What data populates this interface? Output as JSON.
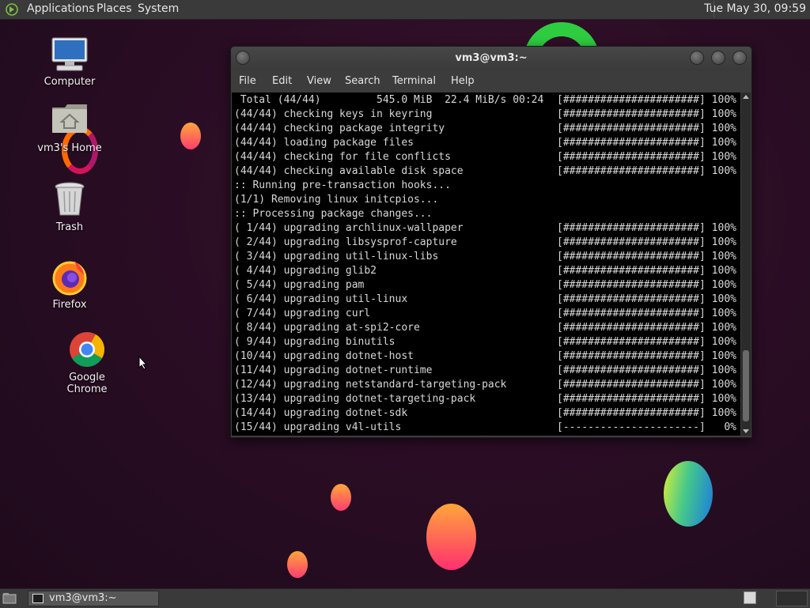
{
  "top_panel": {
    "menus": [
      "Applications",
      "Places",
      "System"
    ],
    "clock": "Tue May 30, 09:59"
  },
  "desktop": {
    "icons": [
      {
        "label": "Computer",
        "icon": "computer-icon"
      },
      {
        "label": "vm3's Home",
        "icon": "home-folder-icon"
      },
      {
        "label": "Trash",
        "icon": "trash-icon"
      },
      {
        "label": "Firefox",
        "icon": "firefox-icon"
      },
      {
        "label": "Google Chrome",
        "icon": "chrome-icon"
      }
    ]
  },
  "window": {
    "title": "vm3@vm3:~",
    "menu": [
      "File",
      "Edit",
      "View",
      "Search",
      "Terminal",
      "Help"
    ]
  },
  "terminal": {
    "lines": [
      {
        "text": " Total (44/44)         545.0 MiB  22.4 MiB/s 00:24",
        "bar": "[######################] 100%"
      },
      {
        "text": "(44/44) checking keys in keyring",
        "bar": "[######################] 100%"
      },
      {
        "text": "(44/44) checking package integrity",
        "bar": "[######################] 100%"
      },
      {
        "text": "(44/44) loading package files",
        "bar": "[######################] 100%"
      },
      {
        "text": "(44/44) checking for file conflicts",
        "bar": "[######################] 100%"
      },
      {
        "text": "(44/44) checking available disk space",
        "bar": "[######################] 100%"
      },
      {
        "text": ":: Running pre-transaction hooks...",
        "bar": ""
      },
      {
        "text": "(1/1) Removing linux initcpios...",
        "bar": ""
      },
      {
        "text": ":: Processing package changes...",
        "bar": ""
      },
      {
        "text": "( 1/44) upgrading archlinux-wallpaper",
        "bar": "[######################] 100%"
      },
      {
        "text": "( 2/44) upgrading libsysprof-capture",
        "bar": "[######################] 100%"
      },
      {
        "text": "( 3/44) upgrading util-linux-libs",
        "bar": "[######################] 100%"
      },
      {
        "text": "( 4/44) upgrading glib2",
        "bar": "[######################] 100%"
      },
      {
        "text": "( 5/44) upgrading pam",
        "bar": "[######################] 100%"
      },
      {
        "text": "( 6/44) upgrading util-linux",
        "bar": "[######################] 100%"
      },
      {
        "text": "( 7/44) upgrading curl",
        "bar": "[######################] 100%"
      },
      {
        "text": "( 8/44) upgrading at-spi2-core",
        "bar": "[######################] 100%"
      },
      {
        "text": "( 9/44) upgrading binutils",
        "bar": "[######################] 100%"
      },
      {
        "text": "(10/44) upgrading dotnet-host",
        "bar": "[######################] 100%"
      },
      {
        "text": "(11/44) upgrading dotnet-runtime",
        "bar": "[######################] 100%"
      },
      {
        "text": "(12/44) upgrading netstandard-targeting-pack",
        "bar": "[######################] 100%"
      },
      {
        "text": "(13/44) upgrading dotnet-targeting-pack",
        "bar": "[######################] 100%"
      },
      {
        "text": "(14/44) upgrading dotnet-sdk",
        "bar": "[######################] 100%"
      },
      {
        "text": "(15/44) upgrading v4l-utils",
        "bar": "[----------------------]   0%"
      }
    ]
  },
  "taskbar": {
    "task_label": "vm3@vm3:~"
  }
}
